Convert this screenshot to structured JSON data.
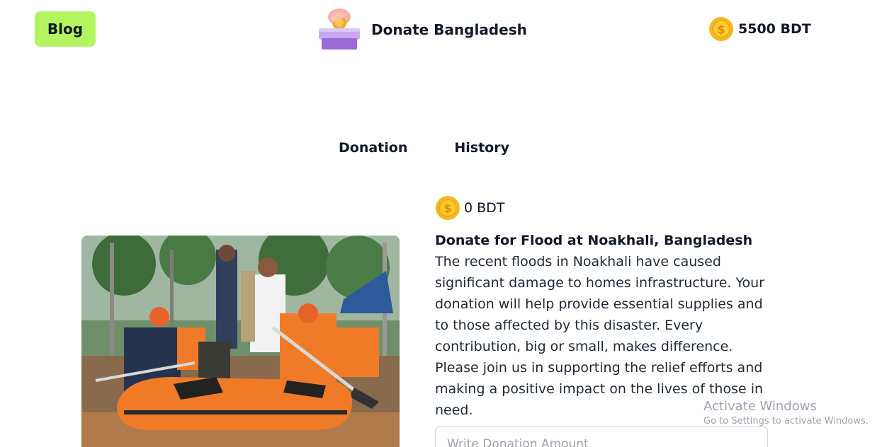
{
  "header": {
    "blog_label": "Blog",
    "brand_title": "Donate Bangladesh",
    "balance": "5500 BDT"
  },
  "tabs": [
    {
      "label": "Donation"
    },
    {
      "label": "History"
    }
  ],
  "card": {
    "amount": "0 BDT",
    "title": "Donate for Flood at Noakhali, Bangladesh",
    "description": "The recent floods in Noakhali have caused significant damage to homes infrastructure. Your donation will help provide essential supplies and to those affected by this disaster. Every contribution, big or small, makes difference. Please join us in supporting the relief efforts and making a positive impact on the lives of those in need.",
    "input_placeholder": "Write Donation Amount",
    "image_icon": "flood-rescue-image"
  },
  "watermark": {
    "title": "Activate Windows",
    "subtitle": "Go to Settings to activate Windows."
  },
  "colors": {
    "blog_button_bg": "#b4f461",
    "coin_gold": "#f5b91e",
    "text_dark": "#111827"
  },
  "icons": {
    "brand": "donation-box-icon",
    "coin": "coin-icon"
  }
}
